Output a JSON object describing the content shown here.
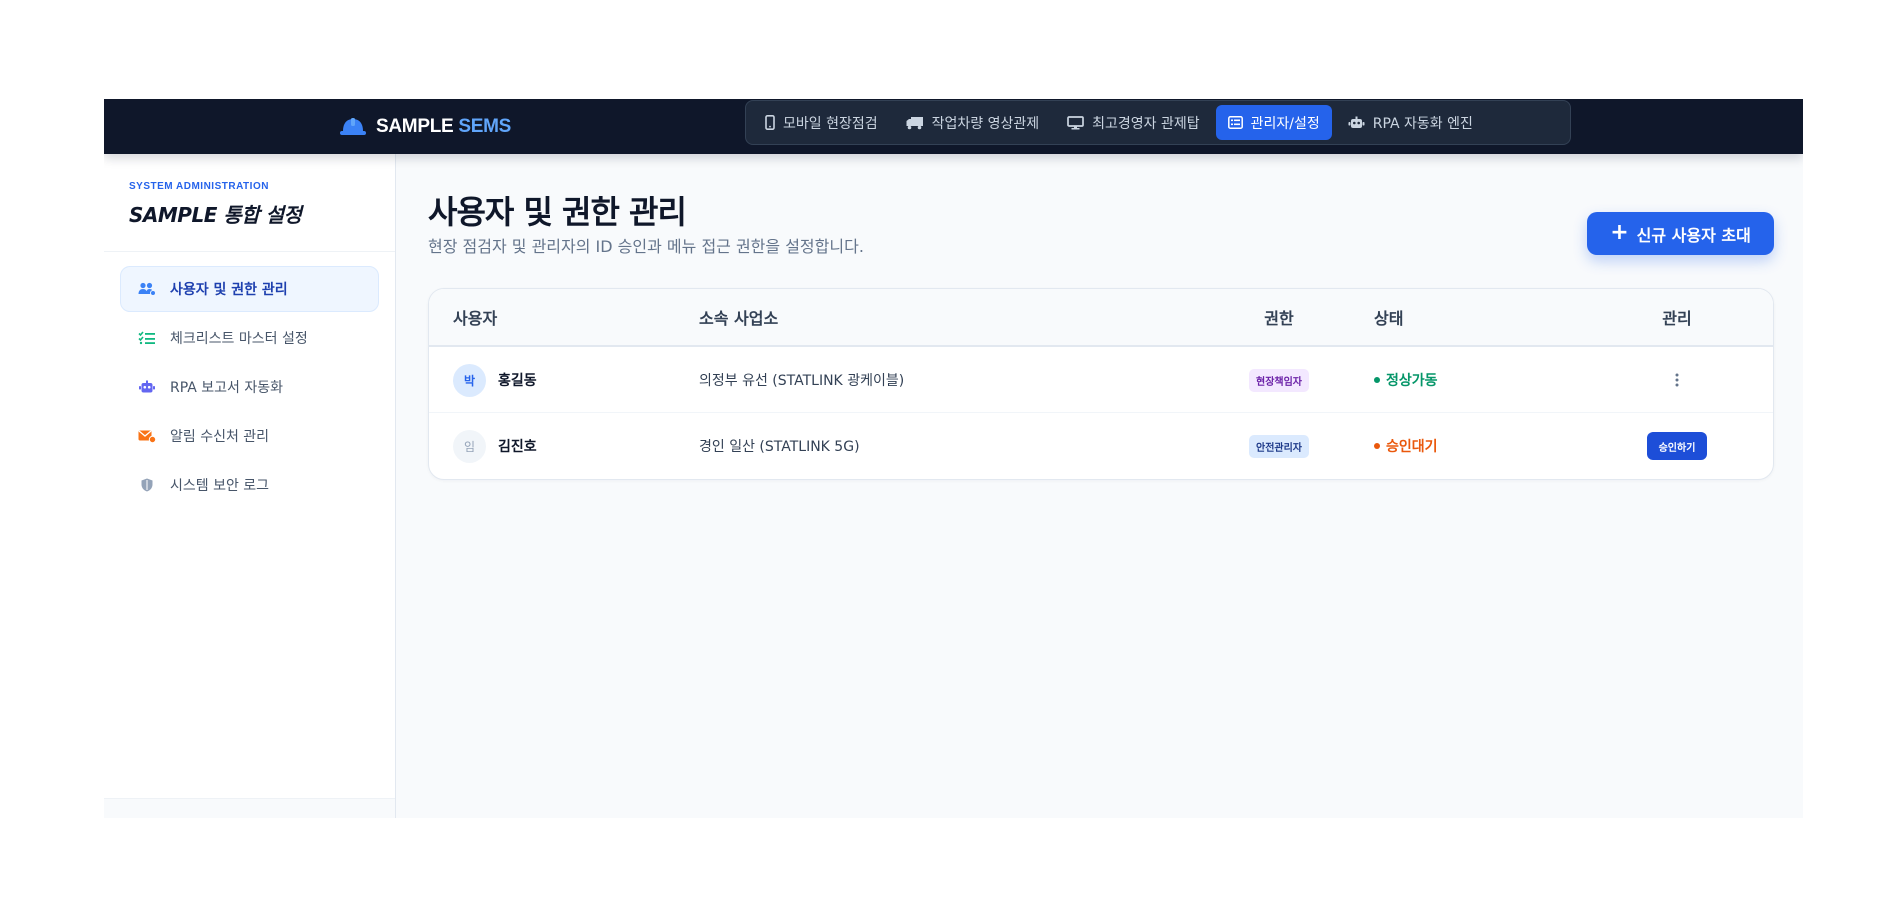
{
  "brand": {
    "name_primary": "SAMPLE",
    "name_accent": "SEMS",
    "icon": "hard-hat-icon"
  },
  "nav": {
    "items": [
      {
        "label": "모바일 현장점검",
        "icon": "mobile-icon",
        "active": false
      },
      {
        "label": "작업차량 영상관제",
        "icon": "truck-icon",
        "active": false
      },
      {
        "label": "최고경영자 관제탑",
        "icon": "monitor-icon",
        "active": false
      },
      {
        "label": "관리자/설정",
        "icon": "list-card-icon",
        "active": true
      },
      {
        "label": "RPA 자동화 엔진",
        "icon": "robot-icon",
        "active": false
      }
    ]
  },
  "sidebar": {
    "eyebrow": "SYSTEM ADMINISTRATION",
    "title": "SAMPLE 통합 설정",
    "items": [
      {
        "label": "사용자 및 권한 관리",
        "icon": "users-cog-icon",
        "icon_color": "#3b82f6",
        "active": true
      },
      {
        "label": "체크리스트 마스터 설정",
        "icon": "list-check-icon",
        "icon_color": "#10b981",
        "active": false
      },
      {
        "label": "RPA 보고서 자동화",
        "icon": "robot-icon",
        "icon_color": "#6366f1",
        "active": false
      },
      {
        "label": "알림 수신처 관리",
        "icon": "mail-bell-icon",
        "icon_color": "#f97316",
        "active": false
      },
      {
        "label": "시스템 보안 로그",
        "icon": "shield-icon",
        "icon_color": "#94a3b8",
        "active": false
      }
    ]
  },
  "main": {
    "title": "사용자 및 권한 관리",
    "subtitle": "현장 점검자 및 관리자의 ID 승인과 메뉴 접근 권한을 설정합니다.",
    "invite_label": "신규 사용자 초대",
    "invite_icon": "plus-icon",
    "table": {
      "headers": {
        "user": "사용자",
        "site": "소속 사업소",
        "role": "권한",
        "status": "상태",
        "manage": "관리"
      },
      "rows": [
        {
          "avatar": "박",
          "name": "홍길동",
          "site": "의정부 유선 (STATLINK 광케이블)",
          "role": "현장책임자",
          "role_color": "purple",
          "status": "정상가동",
          "status_kind": "ok",
          "action": "more-icon"
        },
        {
          "avatar": "임",
          "name": "김진호",
          "site": "경인 일산 (STATLINK 5G)",
          "role": "안전관리자",
          "role_color": "blue",
          "status": "승인대기",
          "status_kind": "wait",
          "action_label": "승인하기"
        }
      ]
    }
  },
  "colors": {
    "topbar": "#0f172a",
    "accent": "#2563eb",
    "ok": "#059669",
    "wait": "#ea580c"
  }
}
